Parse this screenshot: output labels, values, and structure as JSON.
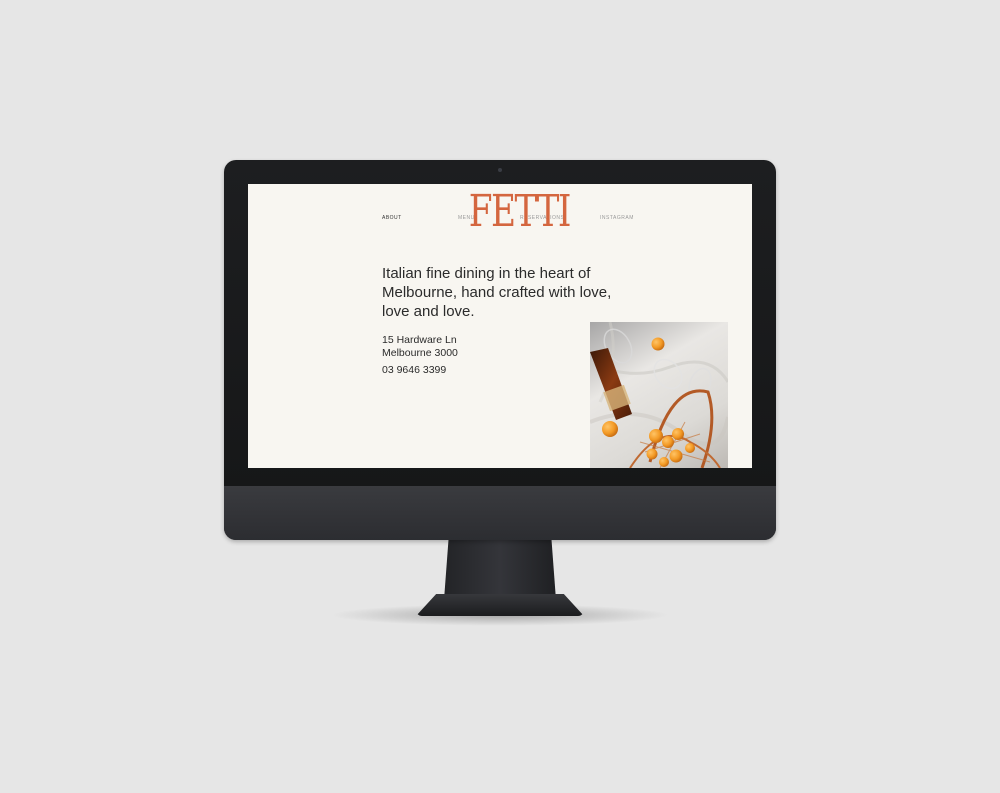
{
  "nav": {
    "about": "ABOUT",
    "menu": "MENU",
    "reservations": "RESERVATIONS",
    "instagram": "INSTAGRAM"
  },
  "brand": {
    "logo_text": "FETTI",
    "accent_color": "#d4663f"
  },
  "hero": {
    "headline": "Italian fine dining in the heart of\nMelbourne, hand crafted with love,\nlove and love."
  },
  "contact": {
    "address_line1": "15 Hardware Ln",
    "address_line2": "Melbourne 3000",
    "phone": "03 9646 3399"
  }
}
